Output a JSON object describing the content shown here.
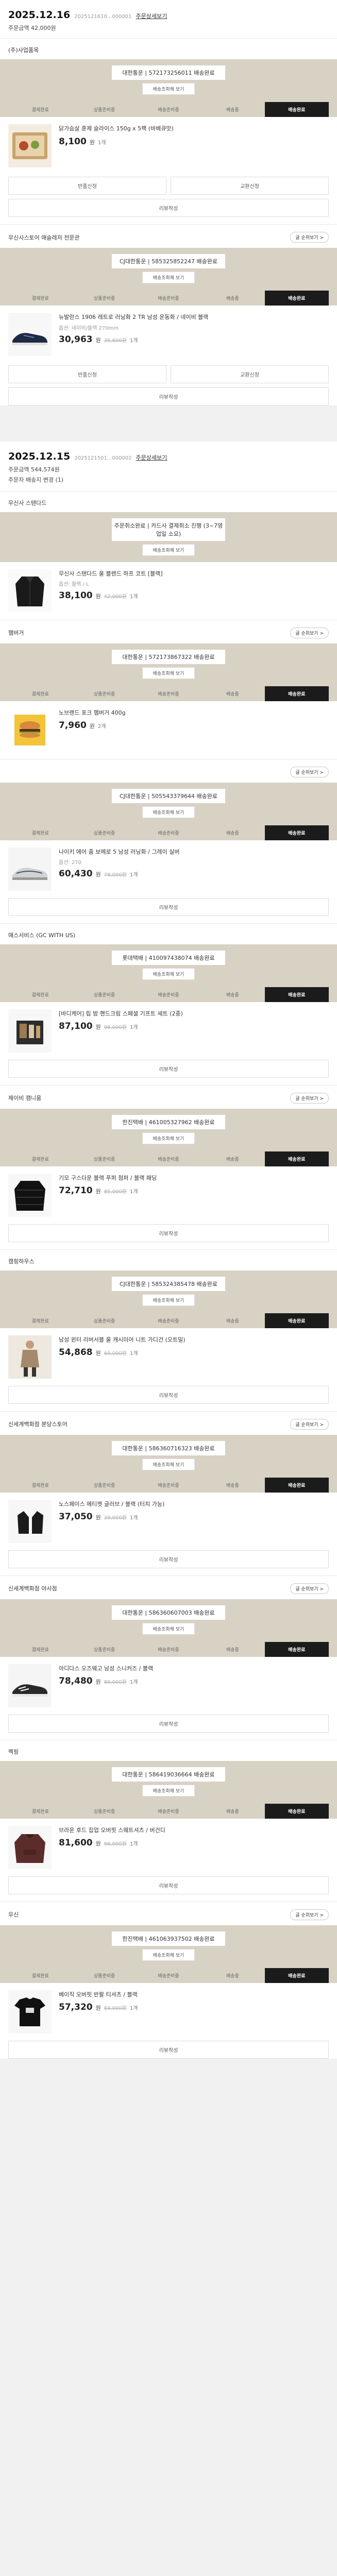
{
  "orders": [
    {
      "date": "2025.12.16",
      "number": "2025121610...000001",
      "detail_link": "주문상세보기",
      "total": "주문금액 42,000원",
      "meta": [],
      "groups": [
        {
          "seller": "(주)사업품목",
          "review_button": "",
          "courier": "대한통운 | 572173256011 배송완료",
          "track_button": "배송조회해 보기",
          "steps": [
            "결제완료",
            "상품준비중",
            "배송준비중",
            "배송중",
            "배송완료"
          ],
          "active_step": 4,
          "items": [
            {
              "thumb": "food",
              "name": "닭가슴살 훈제 슬라이스 150g x 5팩 (바베큐맛)",
              "option": "",
              "price": "8,100",
              "won": "원",
              "original": "",
              "qty": "1개"
            }
          ],
          "buttons": [
            "반품신청",
            "교환신청"
          ],
          "wide_button": "리뷰작성"
        },
        {
          "seller": "무신사스토어 애슬레저 전문관",
          "review_button": "글 순위보기 >",
          "courier": "CJ대한통운 | 585325852247 배송완료",
          "track_button": "배송조회해 보기",
          "steps": [
            "결제완료",
            "상품준비중",
            "배송준비중",
            "배송중",
            "배송완료"
          ],
          "active_step": 4,
          "items": [
            {
              "thumb": "shoe_blue",
              "name": "뉴발란스 1906 레트로 러닝화 2 TR 남성 운동화 / 네이비 블랙",
              "option": "옵션: 네이비/블랙 270mm",
              "price": "30,963",
              "won": "원",
              "original": "35,600원",
              "qty": "1개"
            }
          ],
          "buttons": [
            "반품신청",
            "교환신청"
          ],
          "wide_button": "리뷰작성"
        }
      ]
    },
    {
      "date": "2025.12.15",
      "number": "2025121501...000002",
      "detail_link": "주문상세보기",
      "total": "주문금액 544,574원",
      "meta": [
        "주문자 배송지 변경 (1)"
      ],
      "groups": [
        {
          "seller": "무신사 스탠다드",
          "review_button": "",
          "courier": "주문취소완료 | 카드사 결제취소 진행 (3~7영업일 소요)",
          "track_button": "배송조회해 보기",
          "steps": [],
          "active_step": -1,
          "items": [
            {
              "thumb": "jacket",
              "name": "무신사 스탠다드 울 블렌드 하프 코트 [블랙]",
              "option": "옵션: 블랙 / L",
              "price": "38,100",
              "won": "원",
              "original": "42,000원",
              "qty": "1개"
            }
          ],
          "buttons": [],
          "wide_button": ""
        },
        {
          "seller": "햄버거",
          "review_button": "글 순위보기 >",
          "courier": "대한통운 | 572173867322 배송완료",
          "track_button": "배송조회해 보기",
          "steps": [
            "결제완료",
            "상품준비중",
            "배송준비중",
            "배송중",
            "배송완료"
          ],
          "active_step": 4,
          "items": [
            {
              "thumb": "burger",
              "name": "노브랜드 포크 햄버거 400g",
              "option": "",
              "price": "7,960",
              "won": "원",
              "original": "",
              "qty": "2개"
            }
          ],
          "buttons": [],
          "wide_button": ""
        },
        {
          "seller": "",
          "review_button": "글 순위보기 >",
          "courier": "CJ대한통운 | 505543379644 배송완료",
          "track_button": "배송조회해 보기",
          "steps": [
            "결제완료",
            "상품준비중",
            "배송준비중",
            "배송중",
            "배송완료"
          ],
          "active_step": 4,
          "items": [
            {
              "thumb": "shoe_grey",
              "name": "나이키 에어 줌 보메로 5 남성 러닝화 / 그레이 실버",
              "option": "옵션: 270",
              "price": "60,430",
              "won": "원",
              "original": "78,000원",
              "qty": "1개"
            }
          ],
          "buttons": [],
          "wide_button": "리뷰작성"
        },
        {
          "seller": "애스서비스 (GC WITH US)",
          "review_button": "",
          "courier": "롯데택배 | 410097438074 배송완료",
          "track_button": "배송조회해 보기",
          "steps": [
            "결제완료",
            "상품준비중",
            "배송준비중",
            "배송중",
            "배송완료"
          ],
          "active_step": 4,
          "items": [
            {
              "thumb": "gift",
              "name": "[바디케어] 립 밤 핸드크림 스페셜 기프트 세트 (2종)",
              "option": "",
              "price": "87,100",
              "won": "원",
              "original": "98,000원",
              "qty": "1개"
            }
          ],
          "buttons": [],
          "wide_button": "리뷰작성"
        },
        {
          "seller": "제이비 캠니움",
          "review_button": "글 순위보기 >",
          "courier": "한진택배 | 461005327962 배송완료",
          "track_button": "배송조회해 보기",
          "steps": [
            "결제완료",
            "상품준비중",
            "배송준비중",
            "배송중",
            "배송완료"
          ],
          "active_step": 4,
          "items": [
            {
              "thumb": "puffer",
              "name": "기모 구스다운 블랙 푸퍼 점퍼 / 블랙 패딩",
              "option": "",
              "price": "72,710",
              "won": "원",
              "original": "85,000원",
              "qty": "1개"
            }
          ],
          "buttons": [],
          "wide_button": "리뷰작성"
        },
        {
          "seller": "캠핑하우스",
          "review_button": "",
          "courier": "CJ대한통운 | 585324385478 배송완료",
          "track_button": "배송조회해 보기",
          "steps": [
            "결제완료",
            "상품준비중",
            "배송준비중",
            "배송중",
            "배송완료"
          ],
          "active_step": 4,
          "items": [
            {
              "thumb": "model",
              "name": "남성 윈터 리버서블 울 캐시미어 니트 가디건 (오트밀)",
              "option": "",
              "price": "54,868",
              "won": "원",
              "original": "69,000원",
              "qty": "1개"
            }
          ],
          "buttons": [],
          "wide_button": "리뷰작성"
        },
        {
          "seller": "신세계백화점 분당스토어",
          "review_button": "글 순위보기 >",
          "courier": "대한통운 | 586360716323 배송완료",
          "track_button": "배송조회해 보기",
          "steps": [
            "결제완료",
            "상품준비중",
            "배송준비중",
            "배송중",
            "배송완료"
          ],
          "active_step": 4,
          "items": [
            {
              "thumb": "gloves",
              "name": "노스페이스 에티켓 글러브 / 블랙 (터치 가능)",
              "option": "",
              "price": "37,050",
              "won": "원",
              "original": "39,000원",
              "qty": "1개"
            }
          ],
          "buttons": [],
          "wide_button": "리뷰작성"
        },
        {
          "seller": "신세계백화점 야사점",
          "review_button": "글 순위보기 >",
          "courier": "대한통운 | 586360607003 배송완료",
          "track_button": "배송조회해 보기",
          "steps": [
            "결제완료",
            "상품준비중",
            "배송준비중",
            "배송중",
            "배송완료"
          ],
          "active_step": 4,
          "items": [
            {
              "thumb": "shoe_dark",
              "name": "아디다스 오즈웨고 남성 스니커즈 / 블랙",
              "option": "",
              "price": "78,480",
              "won": "원",
              "original": "89,000원",
              "qty": "1개"
            }
          ],
          "buttons": [],
          "wide_button": "리뷰작성"
        },
        {
          "seller": "멕핑",
          "review_button": "",
          "courier": "대한통운 | 586419036664 배송완료",
          "track_button": "배송조회해 보기",
          "steps": [
            "결제완료",
            "상품준비중",
            "배송준비중",
            "배송중",
            "배송완료"
          ],
          "active_step": 4,
          "items": [
            {
              "thumb": "hoodie",
              "name": "브라운 후드 집업 오버핏 스웨트셔츠 / 버건디",
              "option": "",
              "price": "81,600",
              "won": "원",
              "original": "96,000원",
              "qty": "1개"
            }
          ],
          "buttons": [],
          "wide_button": "리뷰작성"
        },
        {
          "seller": "무신",
          "review_button": "글 순위보기 >",
          "courier": "한진택배 | 461063937502 배송완료",
          "track_button": "배송조회해 보기",
          "steps": [
            "결제완료",
            "상품준비중",
            "배송준비중",
            "배송중",
            "배송완료"
          ],
          "active_step": 4,
          "items": [
            {
              "thumb": "tshirt",
              "name": "베이직 오버핏 반팔 티셔츠 / 블랙",
              "option": "",
              "price": "57,320",
              "won": "원",
              "original": "69,000원",
              "qty": "1개"
            }
          ],
          "buttons": [],
          "wide_button": "리뷰작성"
        }
      ]
    }
  ]
}
